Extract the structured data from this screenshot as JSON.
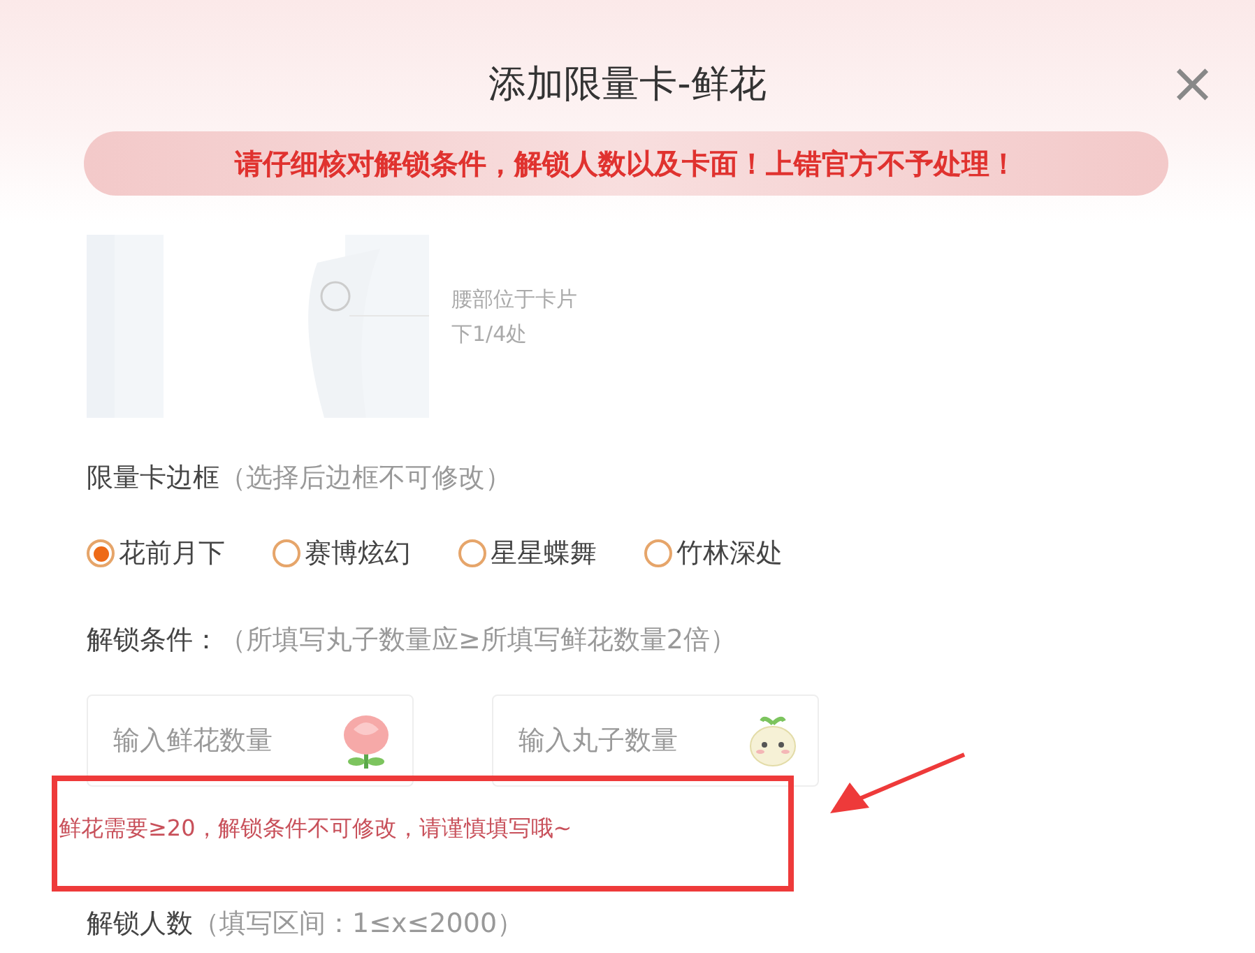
{
  "dialog": {
    "title": "添加限量卡-鲜花",
    "close": "×"
  },
  "warning": "请仔细核对解锁条件，解锁人数以及卡面！上错官方不予处理！",
  "card_preview": {
    "kind": "picture",
    "note_lines": [
      "腰部位于卡片",
      "下1/4处"
    ]
  },
  "frame_section": {
    "label": "限量卡边框",
    "hint": "（选择后边框不可修改）",
    "options": [
      {
        "label": "花前月下",
        "selected": true
      },
      {
        "label": "赛博炫幻",
        "selected": false
      },
      {
        "label": "星星蝶舞",
        "selected": false
      },
      {
        "label": "竹林深处",
        "selected": false
      }
    ]
  },
  "unlock_condition": {
    "label": "解锁条件：",
    "hint": "（所填写丸子数量应≥所填写鲜花数量2倍）",
    "fields": [
      {
        "placeholder": "输入鲜花数量",
        "kind": "flower"
      },
      {
        "placeholder": "输入丸子数量",
        "kind": "dumpling"
      }
    ],
    "notice": "鲜花需要≥20，解锁条件不可修改，请谨慎填写哦~"
  },
  "unlock_count": {
    "label": "解锁人数",
    "hint": "（填写区间：1≤x≤2000）"
  }
}
